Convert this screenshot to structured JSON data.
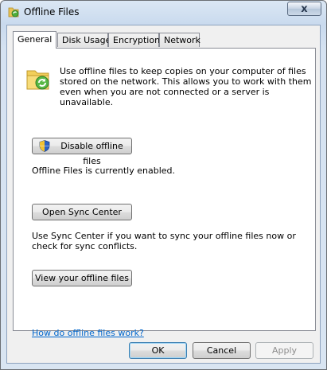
{
  "window": {
    "title": "Offline Files",
    "close_glyph": "x"
  },
  "tabs": [
    {
      "label": "General",
      "selected": true
    },
    {
      "label": "Disk Usage",
      "selected": false
    },
    {
      "label": "Encryption",
      "selected": false
    },
    {
      "label": "Network",
      "selected": false
    }
  ],
  "general": {
    "description": "Use offline files to keep copies on your computer of files stored on the network.  This allows you to work with them even when you are not connected or a server is unavailable.",
    "disable_button": "Disable offline files",
    "status": "Offline Files is currently enabled.",
    "sync_button": "Open Sync Center",
    "sync_description": "Use Sync Center if you want to sync your offline files now or check for sync conflicts.",
    "view_button": "View your offline files",
    "help_link": "How do offline files work?"
  },
  "footer": {
    "ok": "OK",
    "cancel": "Cancel",
    "apply": "Apply"
  },
  "icons": {
    "app": "offline-files-icon",
    "folder": "sync-folder-icon",
    "shield": "uac-shield-icon"
  }
}
